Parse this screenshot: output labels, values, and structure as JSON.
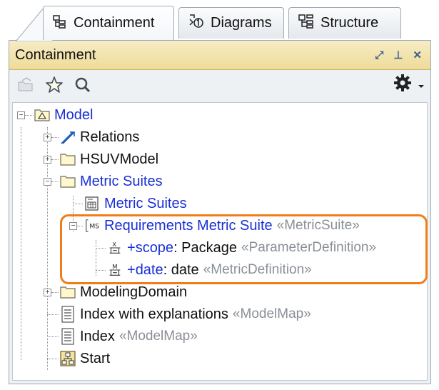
{
  "tabs": [
    {
      "label": "Containment",
      "icon": "containment-icon",
      "active": true
    },
    {
      "label": "Diagrams",
      "icon": "diagrams-icon",
      "active": false
    },
    {
      "label": "Structure",
      "icon": "structure-icon",
      "active": false
    }
  ],
  "panel": {
    "title": "Containment",
    "title_buttons": [
      "⤢",
      "⊥",
      "✕"
    ]
  },
  "toolbar": {
    "items": [
      "open-package-icon",
      "star-icon",
      "search-icon",
      "gear-icon",
      "dropdown-arrow-icon"
    ]
  },
  "tree": {
    "model": {
      "label": "Model"
    },
    "relations": {
      "label": "Relations"
    },
    "hsuv": {
      "label": "HSUVModel"
    },
    "metric_suites_pkg": {
      "label": "Metric Suites"
    },
    "metric_suites_diag": {
      "label": "Metric Suites"
    },
    "req_suite": {
      "label": "Requirements Metric Suite",
      "stereotype": "«MetricSuite»"
    },
    "scope": {
      "prefix": "+",
      "name": "scope",
      "type": " : Package",
      "stereotype": "«ParameterDefinition»"
    },
    "date": {
      "prefix": "+",
      "name": "date",
      "type": " : date",
      "stereotype": "«MetricDefinition»"
    },
    "modeling_domain": {
      "label": "ModelingDomain"
    },
    "index_expl": {
      "label": "Index with explanations",
      "stereotype": "«ModelMap»"
    },
    "index": {
      "label": "Index",
      "stereotype": "«ModelMap»"
    },
    "start": {
      "label": "Start"
    }
  },
  "colors": {
    "highlight": "#f07d1a",
    "link_blue": "#1a2fd6",
    "title_bar": "#efdc9a"
  }
}
